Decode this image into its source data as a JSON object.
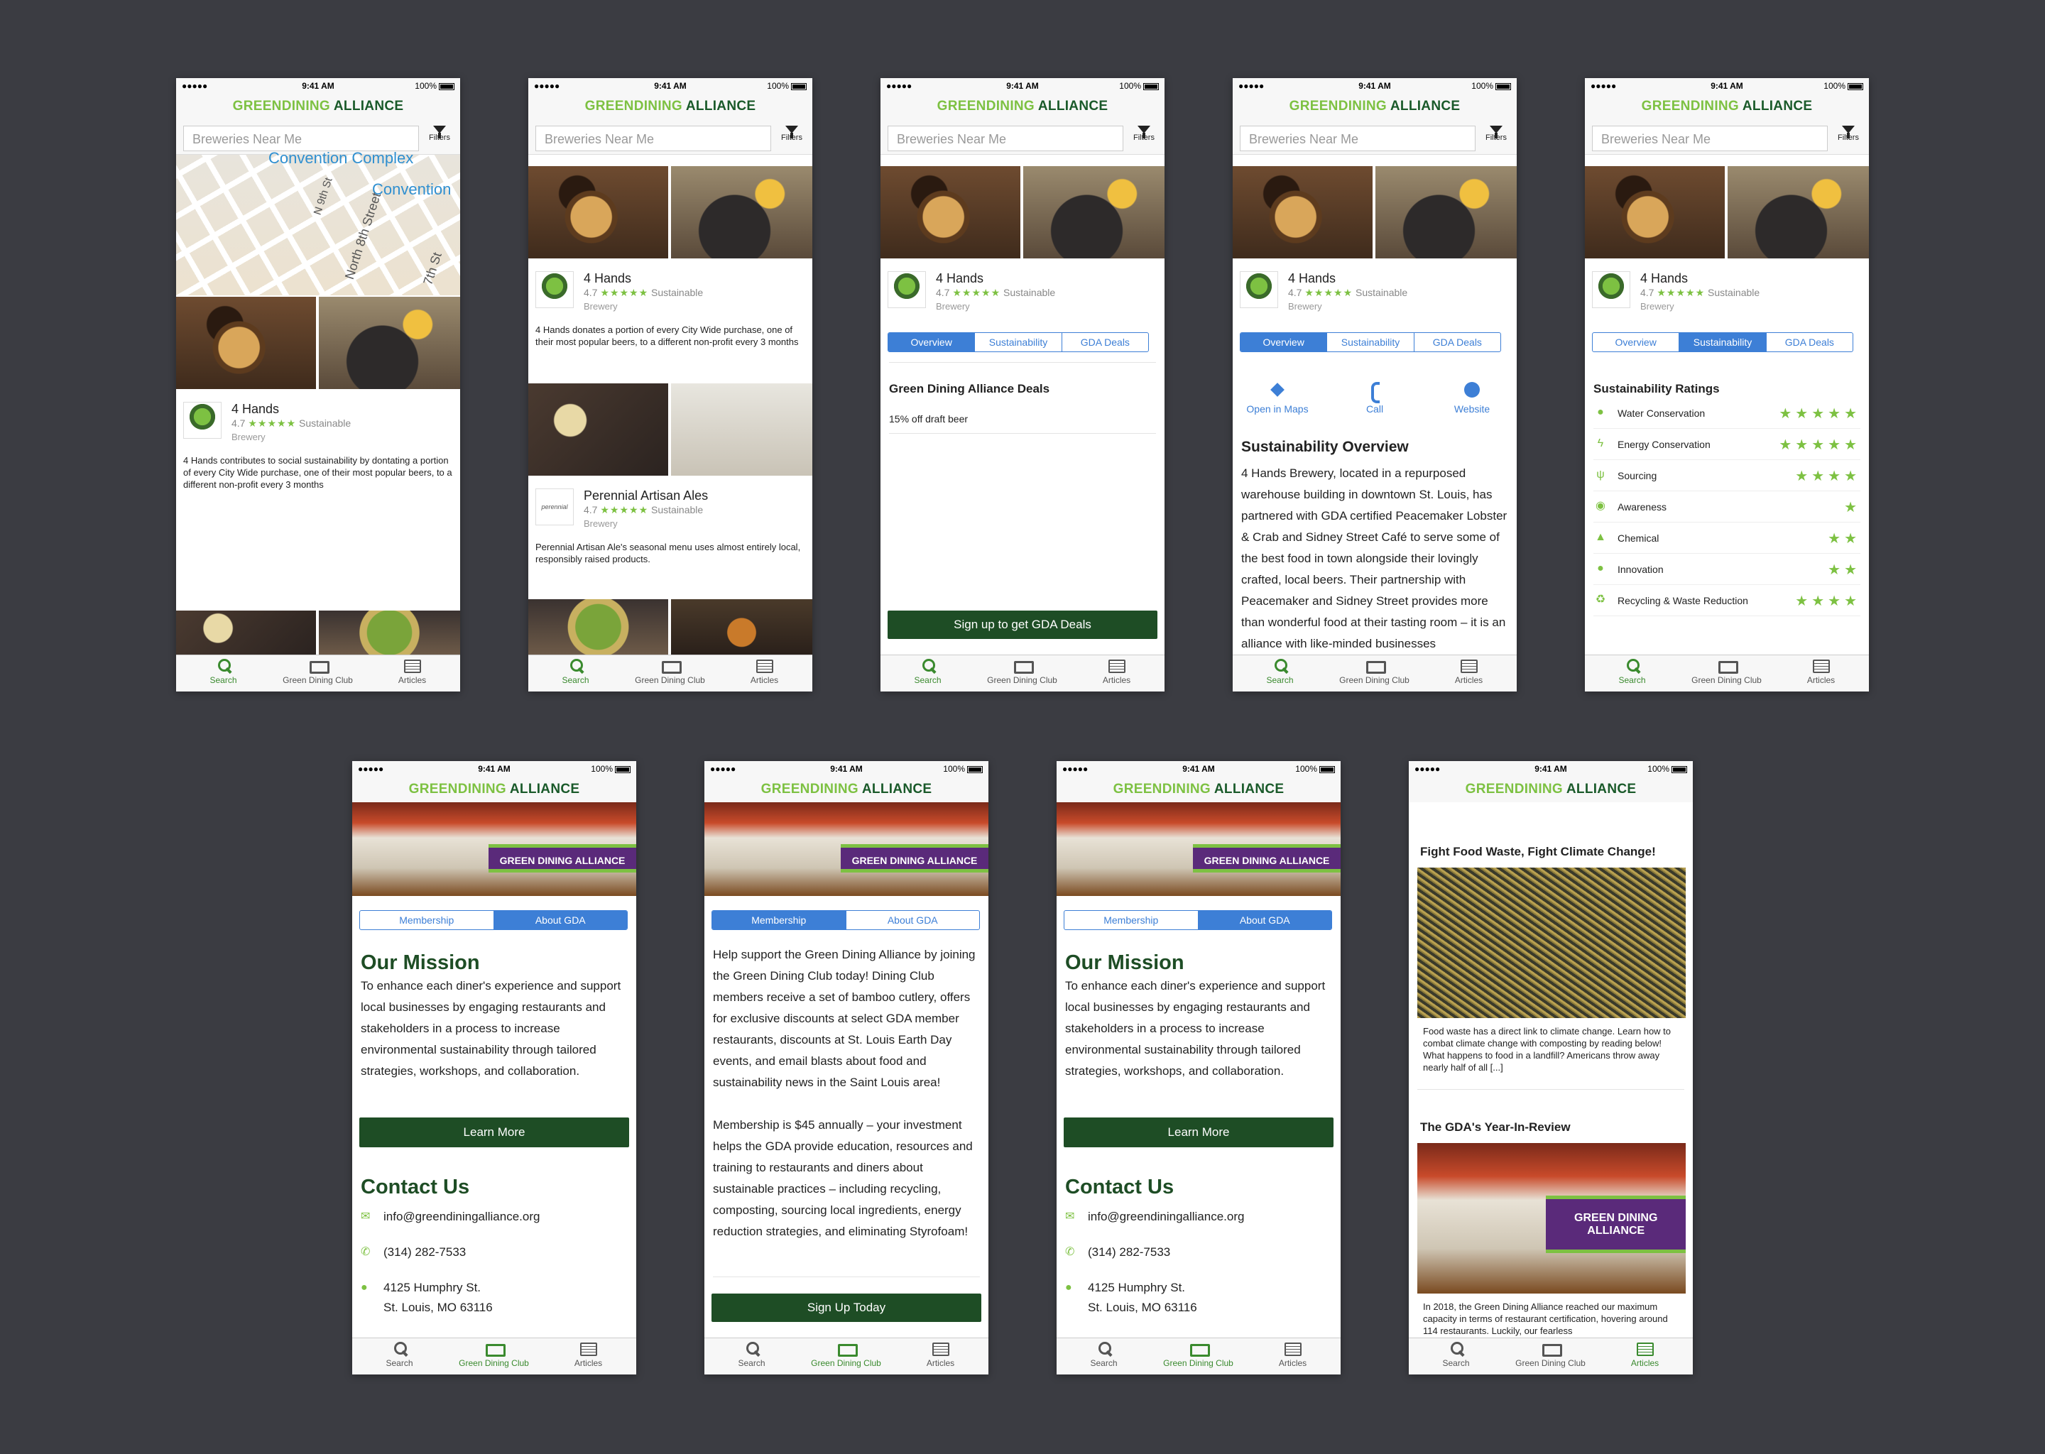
{
  "status": {
    "signal": "●●●●● ",
    "time": "9:41 AM",
    "battery": "100%"
  },
  "brand": {
    "part1": "GREENDINING",
    "part2": " ALLIANCE"
  },
  "search": {
    "placeholder": "Breweries Near Me",
    "filters_label": "Filters"
  },
  "tabs": {
    "search": "Search",
    "club": "Green Dining Club",
    "articles": "Articles"
  },
  "map": {
    "label_top": "Convention Complex",
    "label_right": "Convention",
    "street_n9": "N 9th St",
    "street_8": "North 8th Street",
    "street_7": "7th St"
  },
  "restaurants": [
    {
      "name": "4 Hands",
      "rating": "4.7",
      "stars": "★★★★★",
      "tag": "Sustainable",
      "type": "Brewery",
      "desc_a": "4 Hands contributes to social sustainability by dontating a portion of every City Wide purchase, one of their most popular beers, to a different non-profit every 3 months",
      "desc_b": "4 Hands donates a portion of every City Wide purchase, one of their most popular beers, to a different non-profit every 3 months"
    },
    {
      "name": "Perennial Artisan Ales",
      "rating": "4.7",
      "stars": "★★★★★",
      "tag": "Sustainable",
      "type": "Brewery",
      "logo_text": "perennial",
      "desc": "Perennial Artisan Ale's seasonal menu uses almost entirely local, responsibly raised products."
    }
  ],
  "detail": {
    "segments": [
      "Overview",
      "Sustainability",
      "GDA Deals"
    ],
    "deals_title": "Green Dining Alliance Deals",
    "deal_1": "15% off draft beer",
    "deals_button": "Sign up to get GDA Deals",
    "actions": [
      "Open in Maps",
      "Call",
      "Website"
    ],
    "overview_title": "Sustainability Overview",
    "overview_text": "4 Hands Brewery, located in a repurposed warehouse building in downtown St. Louis, has partnered with GDA certified Peacemaker Lobster & Crab and Sidney Street Café to serve some of the best food in town alongside their lovingly crafted, local beers. Their partnership with Peacemaker and Sidney Street provides more than wonderful food at their tasting room – it is an alliance with like-minded businesses",
    "ratings_title": "Sustainability Ratings",
    "ratings": [
      {
        "label": "Water Conservation",
        "icon": "water-drop-icon",
        "glyph": "●",
        "stars": "★★★★★"
      },
      {
        "label": "Energy Conservation",
        "icon": "lightning-icon",
        "glyph": "ϟ",
        "stars": "★★★★★"
      },
      {
        "label": "Sourcing",
        "icon": "utensils-icon",
        "glyph": "ψ",
        "stars": "★★★★"
      },
      {
        "label": "Awareness",
        "icon": "eye-icon",
        "glyph": "◉",
        "stars": "★"
      },
      {
        "label": "Chemical",
        "icon": "flask-icon",
        "glyph": "▲",
        "stars": "★★"
      },
      {
        "label": "Innovation",
        "icon": "lightbulb-icon",
        "glyph": "●",
        "stars": "★★"
      },
      {
        "label": "Recycling & Waste Reduction",
        "icon": "recycle-icon",
        "glyph": "♻",
        "stars": "★★★★"
      }
    ]
  },
  "club": {
    "segments": [
      "Membership",
      "About GDA"
    ],
    "banner_text": "GREEN DINING ALLIANCE",
    "mission_title": "Our Mission",
    "mission_text": "To enhance each diner's experience and support local businesses by engaging restaurants and stakeholders in a process to increase environmental sustainability through tailored strategies, workshops, and collaboration.",
    "learn_more": "Learn More",
    "contact_title": "Contact Us",
    "email": "info@greendiningalliance.org",
    "phone": "(314) 282-7533",
    "address_1": "4125 Humphry St.",
    "address_2": "St. Louis, MO 63116",
    "membership_text_1": "Help support the Green Dining Alliance by joining the Green Dining Club today! Dining Club members receive a set of bamboo cutlery, offers for exclusive discounts at select GDA member restaurants, discounts at St. Louis Earth Day events, and email blasts about food and sustainability news in the Saint Louis area!",
    "membership_text_2": "Membership is $45 annually – your investment helps the GDA provide education, resources and training to restaurants and diners about sustainable practices – including recycling, composting, sourcing local ingredients, energy reduction strategies, and eliminating Styrofoam!",
    "signup": "Sign Up Today"
  },
  "articles": [
    {
      "title": "Fight Food Waste, Fight Climate Change!",
      "desc": "Food waste has a direct link to climate change. Learn how to combat climate change with composting by reading below!  What happens to food in a landfill? Americans throw away nearly half of all [...]"
    },
    {
      "title": "The GDA's Year-In-Review",
      "desc": "In 2018, the Green Dining Alliance reached our maximum capacity in terms of restaurant certification, hovering around 114 restaurants. Luckily, our fearless"
    }
  ]
}
